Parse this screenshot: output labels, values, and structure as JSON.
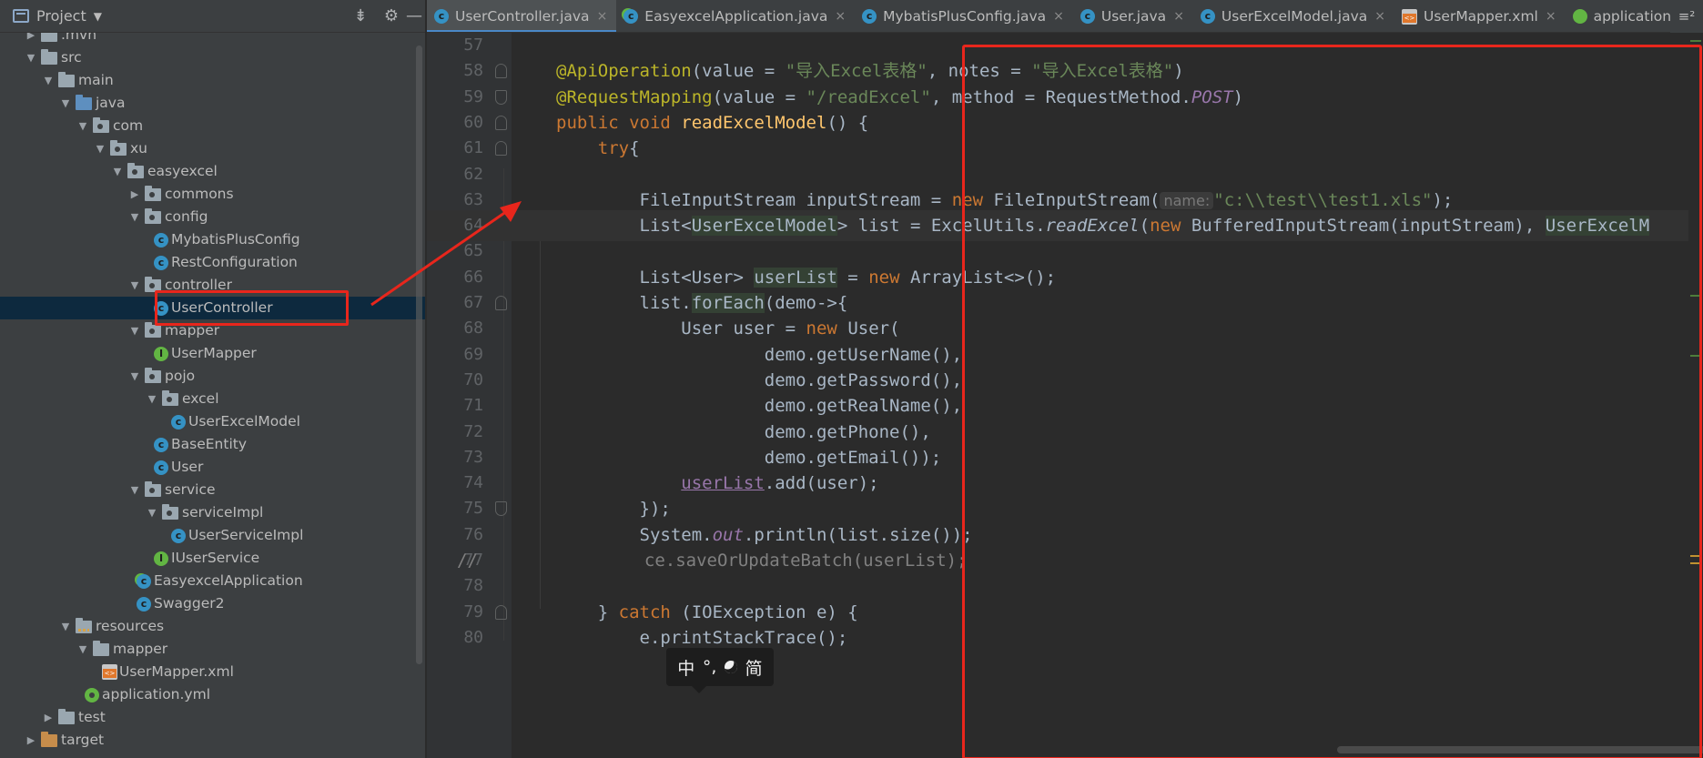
{
  "project_panel": {
    "title": "Project",
    "tree": [
      {
        "label": ".mvn",
        "kind": "folder",
        "depth": 0,
        "expanded": false
      },
      {
        "label": "src",
        "kind": "folder",
        "depth": 0,
        "expanded": true
      },
      {
        "label": "main",
        "kind": "folder",
        "depth": 1,
        "expanded": true
      },
      {
        "label": "java",
        "kind": "src-folder",
        "depth": 2,
        "expanded": true
      },
      {
        "label": "com",
        "kind": "package",
        "depth": 3,
        "expanded": true
      },
      {
        "label": "xu",
        "kind": "package",
        "depth": 4,
        "expanded": true
      },
      {
        "label": "easyexcel",
        "kind": "package",
        "depth": 5,
        "expanded": true
      },
      {
        "label": "commons",
        "kind": "package",
        "depth": 6,
        "expanded": false
      },
      {
        "label": "config",
        "kind": "package",
        "depth": 6,
        "expanded": true
      },
      {
        "label": "MybatisPlusConfig",
        "kind": "class",
        "depth": 7
      },
      {
        "label": "RestConfiguration",
        "kind": "class",
        "depth": 7
      },
      {
        "label": "controller",
        "kind": "package",
        "depth": 6,
        "expanded": true
      },
      {
        "label": "UserController",
        "kind": "class",
        "depth": 7,
        "selected": true
      },
      {
        "label": "mapper",
        "kind": "package",
        "depth": 6,
        "expanded": true
      },
      {
        "label": "UserMapper",
        "kind": "interface",
        "depth": 7
      },
      {
        "label": "pojo",
        "kind": "package",
        "depth": 6,
        "expanded": true
      },
      {
        "label": "excel",
        "kind": "package",
        "depth": 7,
        "expanded": true
      },
      {
        "label": "UserExcelModel",
        "kind": "class",
        "depth": 8
      },
      {
        "label": "BaseEntity",
        "kind": "class",
        "depth": 7
      },
      {
        "label": "User",
        "kind": "class",
        "depth": 7
      },
      {
        "label": "service",
        "kind": "package",
        "depth": 6,
        "expanded": true
      },
      {
        "label": "serviceImpl",
        "kind": "package",
        "depth": 7,
        "expanded": true
      },
      {
        "label": "UserServiceImpl",
        "kind": "class",
        "depth": 8
      },
      {
        "label": "IUserService",
        "kind": "interface",
        "depth": 7
      },
      {
        "label": "EasyexcelApplication",
        "kind": "spring-class",
        "depth": 6
      },
      {
        "label": "Swagger2",
        "kind": "class",
        "depth": 6
      },
      {
        "label": "resources",
        "kind": "res-folder",
        "depth": 2,
        "expanded": true
      },
      {
        "label": "mapper",
        "kind": "folder",
        "depth": 3,
        "expanded": true
      },
      {
        "label": "UserMapper.xml",
        "kind": "xml",
        "depth": 4
      },
      {
        "label": "application.yml",
        "kind": "yml",
        "depth": 3
      },
      {
        "label": "test",
        "kind": "folder",
        "depth": 1,
        "expanded": false
      },
      {
        "label": "target",
        "kind": "target-folder",
        "depth": 0,
        "expanded": false
      }
    ]
  },
  "editor": {
    "tabs": [
      {
        "label": "UserController.java",
        "icon": "class-icon",
        "active": true
      },
      {
        "label": "EasyexcelApplication.java",
        "icon": "spring-class-icon",
        "active": false
      },
      {
        "label": "MybatisPlusConfig.java",
        "icon": "class-icon",
        "active": false
      },
      {
        "label": "User.java",
        "icon": "class-icon",
        "active": false
      },
      {
        "label": "UserExcelModel.java",
        "icon": "class-icon",
        "active": false
      },
      {
        "label": "UserMapper.xml",
        "icon": "xml-icon",
        "active": false
      },
      {
        "label": "application.yr",
        "icon": "yml-icon",
        "active": false
      }
    ],
    "tab_overflow": "≡²",
    "current_line": 64,
    "lines": [
      {
        "n": 57,
        "tokens": []
      },
      {
        "n": 58,
        "tokens": [
          [
            "an",
            "@ApiOperation"
          ],
          [
            "pl",
            "("
          ],
          [
            "pl",
            "value = "
          ],
          [
            "st",
            "\"导入Excel表格\""
          ],
          [
            "pl",
            ", "
          ],
          [
            "pl",
            "notes = "
          ],
          [
            "st",
            "\"导入Excel表格\""
          ],
          [
            "pl",
            ")"
          ]
        ]
      },
      {
        "n": 59,
        "tokens": [
          [
            "an",
            "@RequestMapping"
          ],
          [
            "pl",
            "(value = "
          ],
          [
            "st",
            "\"/readExcel\""
          ],
          [
            "pl",
            ", method = RequestMethod."
          ],
          [
            "st-f",
            "POST"
          ],
          [
            "pl",
            ")"
          ]
        ]
      },
      {
        "n": 60,
        "tokens": [
          [
            "kw",
            "public void "
          ],
          [
            "fn",
            "readExcelModel"
          ],
          [
            "pl",
            "() {"
          ]
        ]
      },
      {
        "n": 61,
        "tokens": [
          [
            "pl",
            "    "
          ],
          [
            "kw",
            "try"
          ],
          [
            "pl",
            "{"
          ]
        ]
      },
      {
        "n": 62,
        "tokens": []
      },
      {
        "n": 63,
        "tokens": [
          [
            "pl",
            "        FileInputStream inputStream = "
          ],
          [
            "kw",
            "new "
          ],
          [
            "pl",
            "FileInputStream("
          ],
          [
            "hint",
            "name:"
          ],
          [
            "st",
            "\"c:\\\\test\\\\test1.xls\""
          ],
          [
            "pl",
            ");"
          ]
        ]
      },
      {
        "n": 64,
        "tokens": [
          [
            "pl",
            "        List<"
          ],
          [
            "hl",
            "UserExcelModel"
          ],
          [
            "pl",
            "> list = ExcelUtils."
          ],
          [
            "it",
            "readExcel"
          ],
          [
            "pl",
            "("
          ],
          [
            "kw",
            "new "
          ],
          [
            "pl",
            "BufferedInputStream(inputStream), "
          ],
          [
            "hl",
            "UserExcelM"
          ]
        ]
      },
      {
        "n": 65,
        "tokens": []
      },
      {
        "n": 66,
        "tokens": [
          [
            "pl",
            "        List<User> "
          ],
          [
            "hl",
            "userList"
          ],
          [
            "pl",
            " = "
          ],
          [
            "kw",
            "new "
          ],
          [
            "pl",
            "ArrayList<>();"
          ]
        ]
      },
      {
        "n": 67,
        "tokens": [
          [
            "pl",
            "        list."
          ],
          [
            "hl",
            "forEach"
          ],
          [
            "pl",
            "(demo->{"
          ]
        ]
      },
      {
        "n": 68,
        "tokens": [
          [
            "pl",
            "            User user = "
          ],
          [
            "kw",
            "new "
          ],
          [
            "pl",
            "User("
          ]
        ]
      },
      {
        "n": 69,
        "tokens": [
          [
            "pl",
            "                    demo.getUserName(),"
          ]
        ]
      },
      {
        "n": 70,
        "tokens": [
          [
            "pl",
            "                    demo.getPassword(),"
          ]
        ]
      },
      {
        "n": 71,
        "tokens": [
          [
            "pl",
            "                    demo.getRealName(),"
          ]
        ]
      },
      {
        "n": 72,
        "tokens": [
          [
            "pl",
            "                    demo.getPhone(),"
          ]
        ]
      },
      {
        "n": 73,
        "tokens": [
          [
            "pl",
            "                    demo.getEmail());"
          ]
        ]
      },
      {
        "n": 74,
        "tokens": [
          [
            "pl",
            "            "
          ],
          [
            "ul",
            "userList"
          ],
          [
            "pl",
            ".add(user);"
          ]
        ]
      },
      {
        "n": 75,
        "tokens": [
          [
            "pl",
            "        });"
          ]
        ]
      },
      {
        "n": 76,
        "tokens": [
          [
            "pl",
            "        System."
          ],
          [
            "st-f",
            "out"
          ],
          [
            "pl",
            ".println(list.size());"
          ]
        ]
      },
      {
        "n": 77,
        "tokens": [
          [
            "cm",
            "//"
          ],
          [
            "pl",
            "                "
          ],
          [
            "cm",
            "ce.saveOrUpdateBatch(userList);"
          ]
        ]
      },
      {
        "n": 78,
        "tokens": []
      },
      {
        "n": 79,
        "tokens": [
          [
            "pl",
            "    } "
          ],
          [
            "kw",
            "catch "
          ],
          [
            "pl",
            "(IOException e) {"
          ]
        ]
      },
      {
        "n": 80,
        "tokens": [
          [
            "pl",
            "        e.printStackTrace();"
          ]
        ]
      }
    ]
  },
  "ime_popup": {
    "lang": "中",
    "punct": "°,",
    "mode": "简"
  },
  "colors": {
    "annotation_box": "#e8261c",
    "selection": "#0d293e",
    "active_tab_accent": "#4a88c7"
  }
}
